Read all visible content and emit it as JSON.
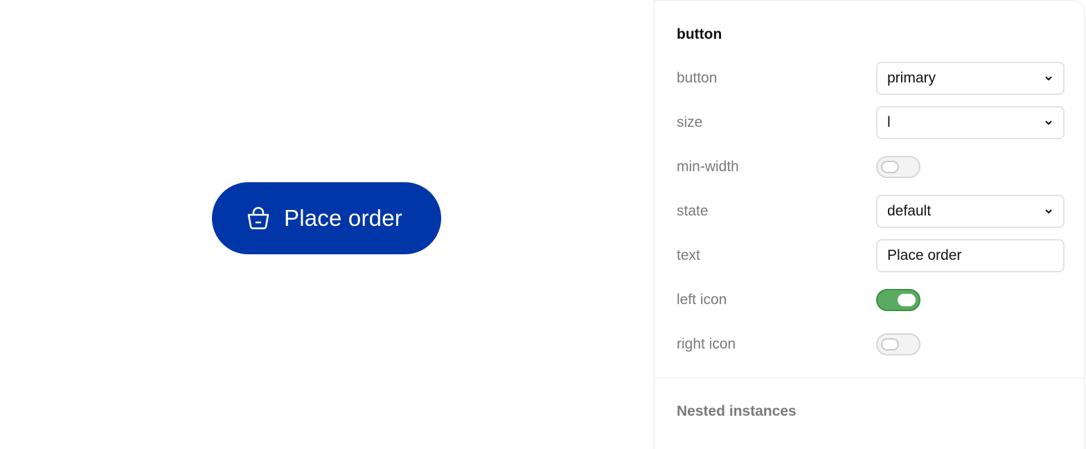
{
  "preview": {
    "button_label": "Place order",
    "button_icon": "shopping-basket-icon",
    "button_color": "#0036a8",
    "label_color": "#ffffff"
  },
  "panel": {
    "title": "button",
    "rows": {
      "button": {
        "label": "button",
        "value": "primary",
        "control": "select"
      },
      "size": {
        "label": "size",
        "value": "l",
        "control": "select"
      },
      "min_width": {
        "label": "min-width",
        "on": false,
        "control": "toggle"
      },
      "state": {
        "label": "state",
        "value": "default",
        "control": "select"
      },
      "text": {
        "label": "text",
        "value": "Place order",
        "control": "text"
      },
      "left_icon": {
        "label": "left icon",
        "on": true,
        "control": "toggle"
      },
      "right_icon": {
        "label": "right icon",
        "on": false,
        "control": "toggle"
      }
    },
    "nested_title": "Nested instances",
    "toggle_on_color": "#5aab62",
    "chevron_icon": "chevron-down-icon"
  }
}
